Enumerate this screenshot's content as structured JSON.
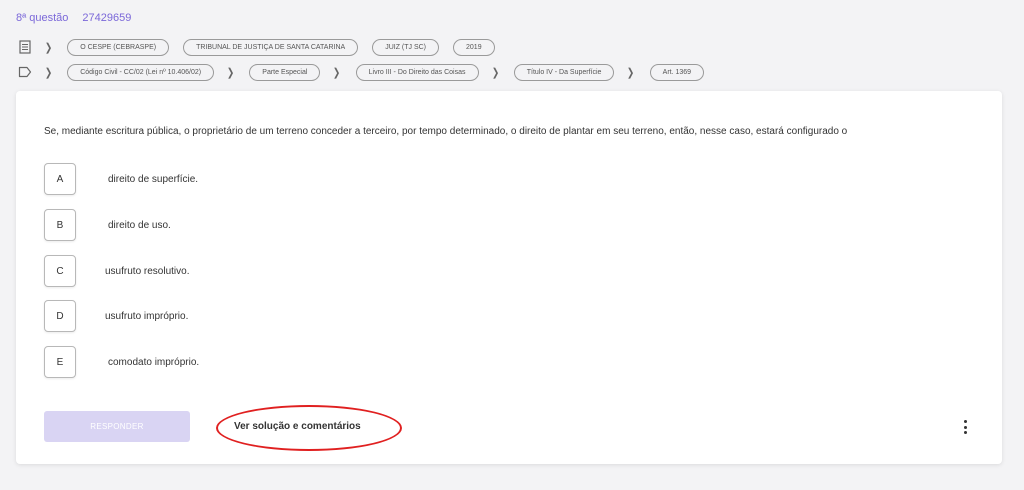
{
  "question": {
    "number_label": "8ª questão",
    "id": "27429659"
  },
  "metadata_row": {
    "icon": "document-icon",
    "chips": [
      "O CESPE (CEBRASPE)",
      "TRIBUNAL DE JUSTIÇA DE SANTA CATARINA",
      "JUIZ (TJ SC)",
      "2019"
    ]
  },
  "subject_row": {
    "icon": "tag-icon",
    "breadcrumbs": [
      "Código Civil - CC/02 (Lei nº 10.406/02)",
      "Parte Especial",
      "Livro III - Do Direito das Coisas",
      "Título IV - Da Superfície",
      "Art. 1369"
    ]
  },
  "statement": "Se, mediante escritura pública, o proprietário de um terreno conceder a terceiro, por tempo determinado, o direito de plantar em seu terreno, então, nesse caso, estará configurado o",
  "options": [
    {
      "letter": "A",
      "text": "direito de superfície."
    },
    {
      "letter": "B",
      "text": "direito de uso."
    },
    {
      "letter": "C",
      "text": "usufruto resolutivo."
    },
    {
      "letter": "D",
      "text": "usufruto impróprio."
    },
    {
      "letter": "E",
      "text": "comodato impróprio."
    }
  ],
  "actions": {
    "respond_label": "RESPONDER",
    "solution_label": "Ver solução e comentários",
    "more_icon": "more-vertical-icon"
  },
  "colors": {
    "accent": "#7b68d9",
    "respond_disabled": "#d9d4f3",
    "annotation": "#e02020"
  }
}
